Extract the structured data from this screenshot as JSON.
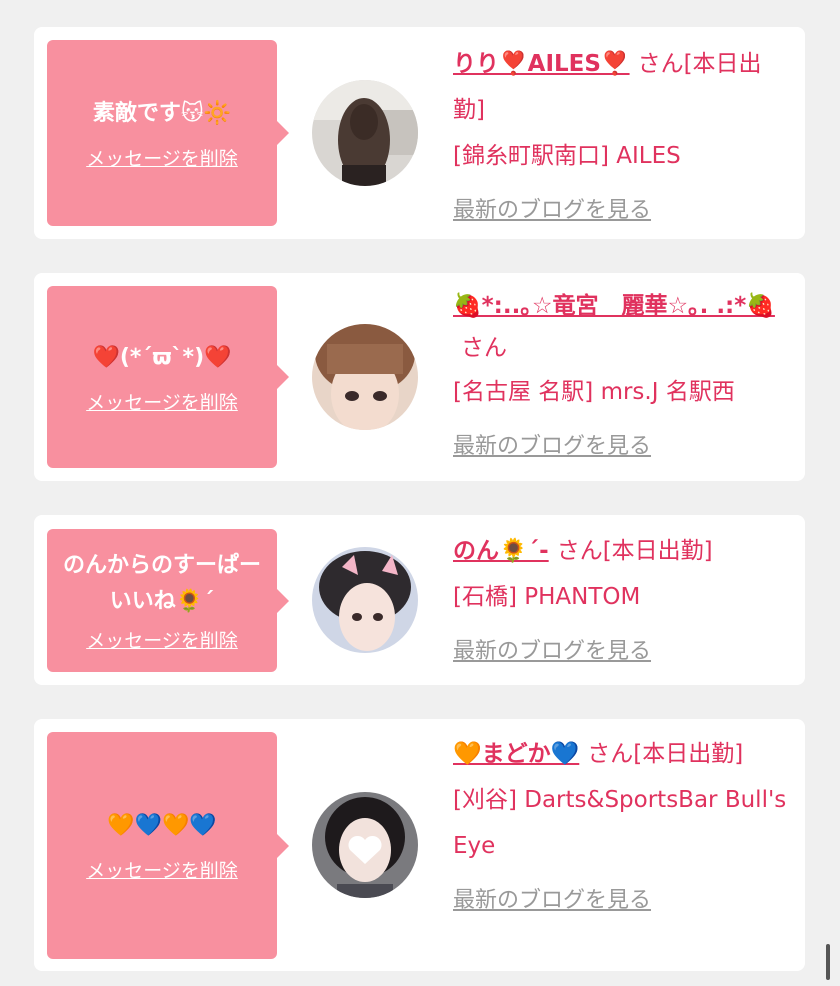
{
  "cards": [
    {
      "message": "素敵です😽🔆",
      "delete_label": "メッセージを削除",
      "name": "りり❣️AILES❣️",
      "suffix": "さん",
      "status": "[本日出勤]",
      "shop": "[錦糸町駅南口] AILES",
      "blog_label": "最新のブログを見る"
    },
    {
      "message": "❤️(*´ϖ`*)❤️",
      "delete_label": "メッセージを削除",
      "name": "🍓*:..｡☆竜宮　麗華☆｡. .:*🍓",
      "suffix": "さん",
      "status": "",
      "shop": "[名古屋 名駅] mrs.J 名駅西",
      "blog_label": "最新のブログを見る"
    },
    {
      "message": "のんからのすーぱーいいね🌻´",
      "delete_label": "メッセージを削除",
      "name": "のん🌻´-",
      "suffix": "さん",
      "status": "[本日出勤]",
      "shop": "[石橋] PHANTOM",
      "blog_label": "最新のブログを見る"
    },
    {
      "message": "🧡💙🧡💙",
      "delete_label": "メッセージを削除",
      "name": "🧡まどか💙",
      "suffix": "さん",
      "status": "[本日出勤]",
      "shop": "[刈谷] Darts&SportsBar Bull's Eye",
      "blog_label": "最新のブログを見る"
    }
  ]
}
